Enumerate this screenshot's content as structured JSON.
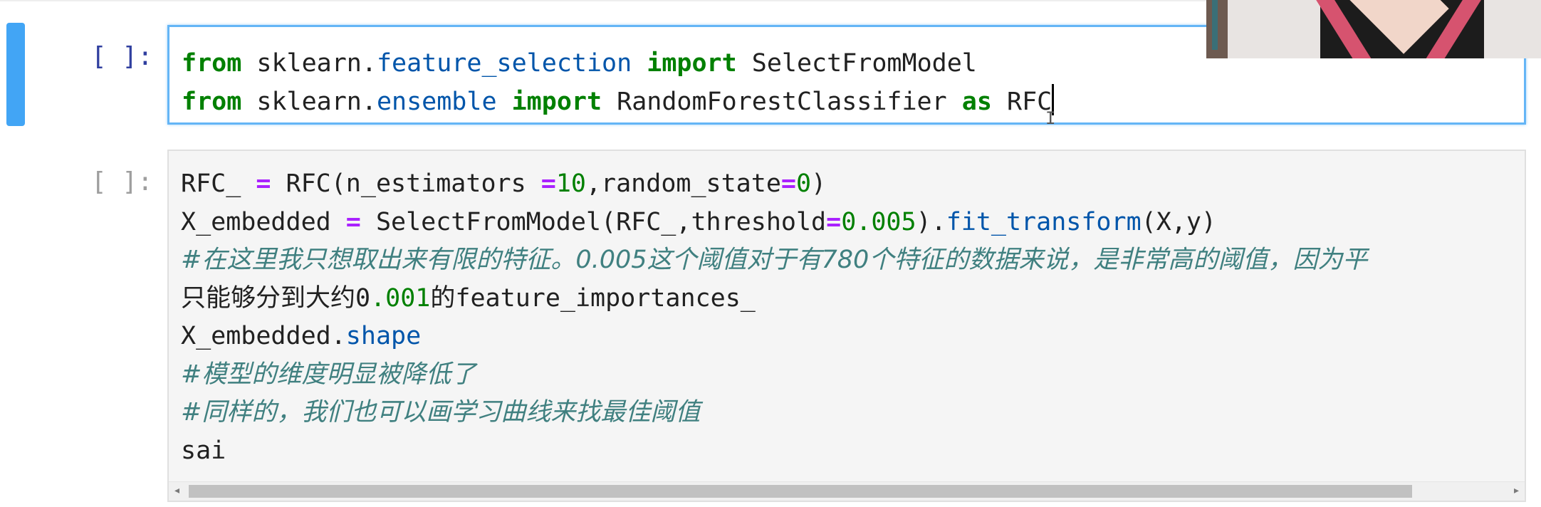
{
  "notebook": {
    "cells": [
      {
        "prompt": "[ ]:",
        "lines": [
          [
            {
              "t": "from",
              "c": "kw"
            },
            {
              "t": " sklearn.",
              "c": ""
            },
            {
              "t": "feature_selection",
              "c": "mod"
            },
            {
              "t": " ",
              "c": ""
            },
            {
              "t": "import",
              "c": "kw"
            },
            {
              "t": " SelectFromModel",
              "c": ""
            }
          ],
          [
            {
              "t": "from",
              "c": "kw"
            },
            {
              "t": " sklearn.",
              "c": ""
            },
            {
              "t": "ensemble",
              "c": "mod"
            },
            {
              "t": " ",
              "c": ""
            },
            {
              "t": "import",
              "c": "kw"
            },
            {
              "t": " RandomForestClassifier ",
              "c": ""
            },
            {
              "t": "as",
              "c": "kw"
            },
            {
              "t": " RFC",
              "c": ""
            }
          ]
        ]
      },
      {
        "prompt": "[ ]:",
        "lines": [
          [
            {
              "t": "RFC_ ",
              "c": ""
            },
            {
              "t": "=",
              "c": "op"
            },
            {
              "t": " RFC(n_estimators ",
              "c": ""
            },
            {
              "t": "=",
              "c": "op"
            },
            {
              "t": "10",
              "c": "num"
            },
            {
              "t": ",random_state",
              "c": ""
            },
            {
              "t": "=",
              "c": "op"
            },
            {
              "t": "0",
              "c": "num"
            },
            {
              "t": ")",
              "c": ""
            }
          ],
          [
            {
              "t": "X_embedded ",
              "c": ""
            },
            {
              "t": "=",
              "c": "op"
            },
            {
              "t": " SelectFromModel(RFC_,threshold",
              "c": ""
            },
            {
              "t": "=",
              "c": "op"
            },
            {
              "t": "0.005",
              "c": "num"
            },
            {
              "t": ").",
              "c": ""
            },
            {
              "t": "fit_transform",
              "c": "attr"
            },
            {
              "t": "(X,y)",
              "c": ""
            }
          ],
          [
            {
              "t": "#在这里我只想取出来有限的特征。0.005这个阈值对于有780个特征的数据来说，是非常高的阈值，因为平",
              "c": "cmt"
            }
          ],
          [
            {
              "t": "只能够分到大约",
              "c": "cjk"
            },
            {
              "t": "0",
              "c": ""
            },
            {
              "t": ".001",
              "c": "num"
            },
            {
              "t": "的",
              "c": "cjk"
            },
            {
              "t": "feature_importances_",
              "c": ""
            }
          ],
          [
            {
              "t": "X_embedded.",
              "c": ""
            },
            {
              "t": "shape",
              "c": "attr"
            }
          ],
          [
            {
              "t": "#模型的维度明显被降低了",
              "c": "cmt"
            }
          ],
          [
            {
              "t": "#同样的，我们也可以画学习曲线来找最佳阈值",
              "c": "cmt"
            }
          ],
          [
            {
              "t": "sai",
              "c": ""
            }
          ]
        ]
      }
    ]
  },
  "scrollbar": {
    "left_arrow": "◂",
    "right_arrow": "▸"
  },
  "cursor": {
    "ibeam": "I"
  },
  "colors": {
    "selection_bar": "#42a5f5",
    "keyword": "#008000",
    "module": "#0055aa",
    "operator": "#aa22ff",
    "comment": "#408080",
    "prompt_active": "#303f9f",
    "prompt_inactive": "#9e9e9e"
  }
}
